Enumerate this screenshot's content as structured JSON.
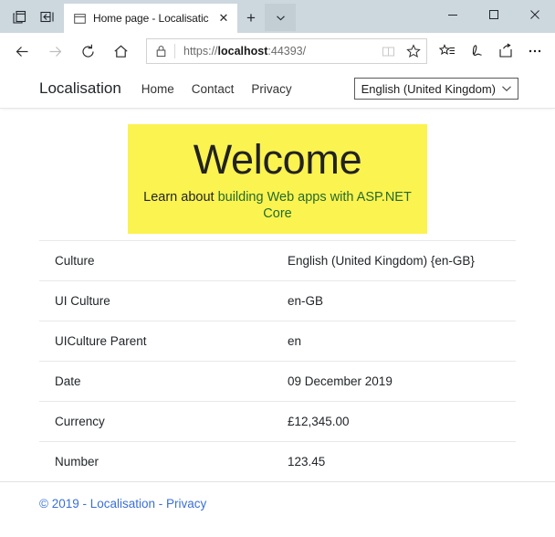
{
  "browser": {
    "tab": {
      "title": "Home page - Localisatic",
      "close_label": "✕"
    },
    "new_tab_label": "+",
    "window_controls": {
      "minimize": "─",
      "maximize": "□",
      "close": "✕"
    },
    "address": {
      "scheme": "https://",
      "host": "localhost",
      "path": ":44393/",
      "full_url": "https://localhost:44393/"
    },
    "icons": {
      "tab_preview": "tab-preview-icon",
      "set_aside": "set-tabs-aside-icon",
      "tab_favicon": "page-icon",
      "tab_list": "tab-list-chevron-icon",
      "back": "back-arrow-icon",
      "forward": "forward-arrow-icon",
      "refresh": "refresh-icon",
      "home": "home-icon",
      "lock": "lock-icon",
      "reading_view": "reading-view-icon",
      "favorite": "star-icon",
      "favorites_hub": "favorites-hub-icon",
      "web_note": "web-note-pen-icon",
      "share": "share-icon",
      "settings": "more-settings-icon"
    }
  },
  "site": {
    "brand": "Localisation",
    "nav": [
      {
        "label": "Home"
      },
      {
        "label": "Contact"
      },
      {
        "label": "Privacy"
      }
    ],
    "language_select": {
      "value": "English (United Kingdom)",
      "caret": "⌄"
    },
    "jumbotron": {
      "title": "Welcome",
      "sub_prefix": "Learn about ",
      "sub_link": "building Web apps with ASP.NET Core",
      "background_color": "#fbf34f",
      "link_color": "#25692f"
    },
    "table": {
      "rows": [
        {
          "label": "Culture",
          "value": "English (United Kingdom) {en-GB}"
        },
        {
          "label": "UI Culture",
          "value": "en-GB"
        },
        {
          "label": "UICulture Parent",
          "value": "en"
        },
        {
          "label": "Date",
          "value": "09 December 2019"
        },
        {
          "label": "Currency",
          "value": "£12,345.00"
        },
        {
          "label": "Number",
          "value": "123.45"
        }
      ]
    },
    "footer": {
      "copyright": "© 2019 - Localisation - ",
      "privacy_link": "Privacy",
      "link_color": "#3a6fd8"
    }
  }
}
